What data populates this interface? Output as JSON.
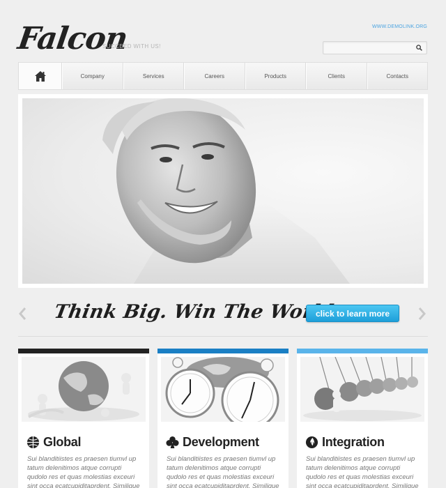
{
  "header": {
    "logo": "Falcon",
    "tagline": "SUCCEED WITH US!",
    "demo_link": "WWW.DEMOLINK.ORG",
    "search_placeholder": ""
  },
  "nav": {
    "home_icon": "home-icon",
    "items": [
      "Company",
      "Services",
      "Careers",
      "Products",
      "Clients",
      "Contacts"
    ]
  },
  "slider": {
    "slogan": "Think Big. Win The World.",
    "cta_label": "click to learn more"
  },
  "cards": [
    {
      "title": "Global",
      "icon": "globe-icon",
      "bar_color": "#222222",
      "text": "Sui blanditiistes es praesen tiumvl up tatum delenitimos atque corrupti qudolo res et quas molestias exceuri sint occa ecatcupiditaprdent. Similique sunt"
    },
    {
      "title": "Development",
      "icon": "club-icon",
      "bar_color": "#1a7fc4",
      "text": "Sui blanditiistes es praesen tiumvl up tatum delenitimos atque corrupti qudolo res et quas molestias exceuri sint occa ecatcupiditaprdent. Similique sunt"
    },
    {
      "title": "Integration",
      "icon": "flame-icon",
      "bar_color": "#5ab4ea",
      "text": "Sui blanditiistes es praesen tiumvl up tatum delenitimos atque corrupti qudolo res et quas molestias exceuri sint occa ecatcupiditaprdent. Similique sunt"
    }
  ],
  "colors": {
    "accent": "#1e9fd9",
    "link": "#4aa3e0",
    "background": "#efefef"
  }
}
